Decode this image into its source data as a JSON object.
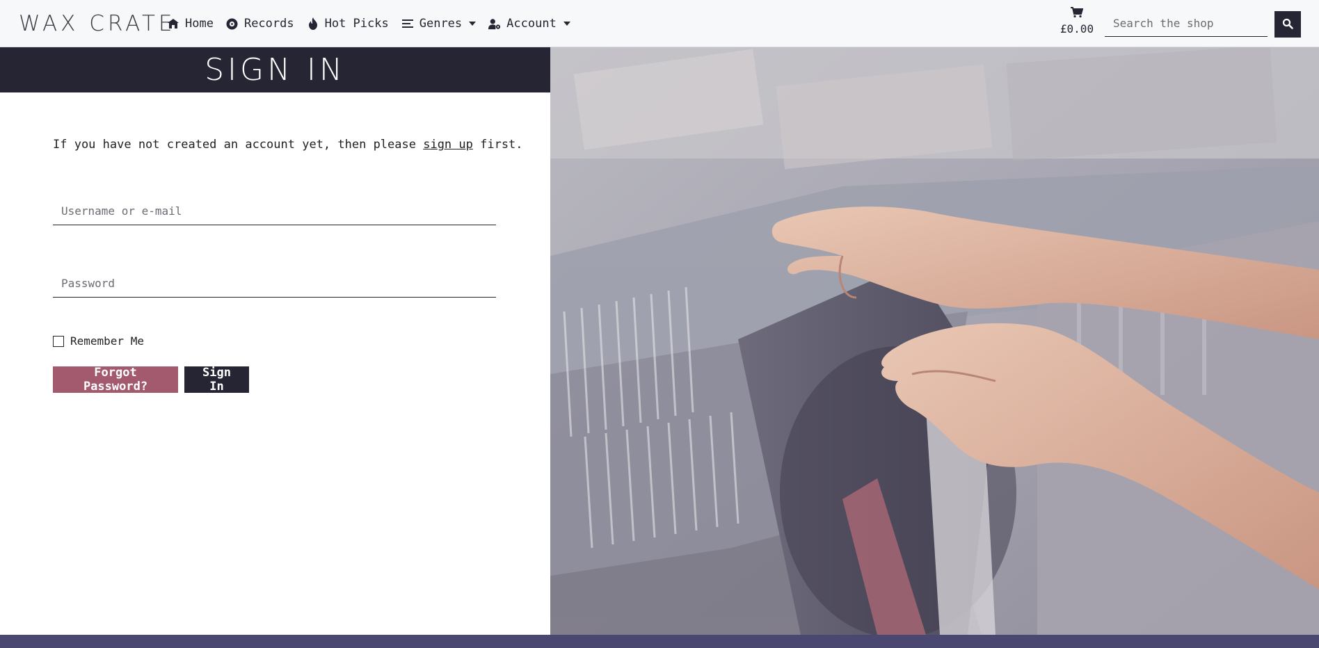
{
  "brand": "WAX CRATE",
  "nav": {
    "home": "Home",
    "records": "Records",
    "hot_picks": "Hot Picks",
    "genres": "Genres",
    "account": "Account"
  },
  "cart": {
    "total": "£0.00",
    "icon": "cart-icon"
  },
  "search": {
    "placeholder": "Search the shop",
    "button_icon": "search-icon"
  },
  "page": {
    "title": "SIGN IN",
    "intro_before": "If you have not created an account yet, then please ",
    "intro_link": "sign up",
    "intro_after": " first."
  },
  "form": {
    "username_placeholder": "Username or e-mail",
    "password_placeholder": "Password",
    "remember_label": "Remember Me",
    "remember_checked": false,
    "forgot_label": "Forgot Password?",
    "signin_label": "Sign In"
  },
  "colors": {
    "navbar_bg": "#f7f8f9",
    "dark": "#252533",
    "accent_rose": "#a35a6f",
    "footer": "#4a4870"
  }
}
